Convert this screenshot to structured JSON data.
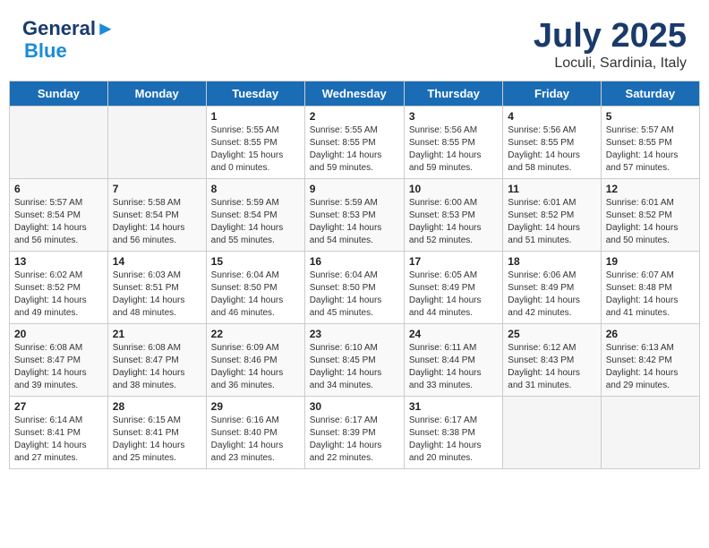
{
  "header": {
    "logo_line1": "General",
    "logo_line2": "Blue",
    "month": "July 2025",
    "location": "Loculi, Sardinia, Italy"
  },
  "weekdays": [
    "Sunday",
    "Monday",
    "Tuesday",
    "Wednesday",
    "Thursday",
    "Friday",
    "Saturday"
  ],
  "weeks": [
    [
      {
        "day": "",
        "info": ""
      },
      {
        "day": "",
        "info": ""
      },
      {
        "day": "1",
        "info": "Sunrise: 5:55 AM\nSunset: 8:55 PM\nDaylight: 15 hours\nand 0 minutes."
      },
      {
        "day": "2",
        "info": "Sunrise: 5:55 AM\nSunset: 8:55 PM\nDaylight: 14 hours\nand 59 minutes."
      },
      {
        "day": "3",
        "info": "Sunrise: 5:56 AM\nSunset: 8:55 PM\nDaylight: 14 hours\nand 59 minutes."
      },
      {
        "day": "4",
        "info": "Sunrise: 5:56 AM\nSunset: 8:55 PM\nDaylight: 14 hours\nand 58 minutes."
      },
      {
        "day": "5",
        "info": "Sunrise: 5:57 AM\nSunset: 8:55 PM\nDaylight: 14 hours\nand 57 minutes."
      }
    ],
    [
      {
        "day": "6",
        "info": "Sunrise: 5:57 AM\nSunset: 8:54 PM\nDaylight: 14 hours\nand 56 minutes."
      },
      {
        "day": "7",
        "info": "Sunrise: 5:58 AM\nSunset: 8:54 PM\nDaylight: 14 hours\nand 56 minutes."
      },
      {
        "day": "8",
        "info": "Sunrise: 5:59 AM\nSunset: 8:54 PM\nDaylight: 14 hours\nand 55 minutes."
      },
      {
        "day": "9",
        "info": "Sunrise: 5:59 AM\nSunset: 8:53 PM\nDaylight: 14 hours\nand 54 minutes."
      },
      {
        "day": "10",
        "info": "Sunrise: 6:00 AM\nSunset: 8:53 PM\nDaylight: 14 hours\nand 52 minutes."
      },
      {
        "day": "11",
        "info": "Sunrise: 6:01 AM\nSunset: 8:52 PM\nDaylight: 14 hours\nand 51 minutes."
      },
      {
        "day": "12",
        "info": "Sunrise: 6:01 AM\nSunset: 8:52 PM\nDaylight: 14 hours\nand 50 minutes."
      }
    ],
    [
      {
        "day": "13",
        "info": "Sunrise: 6:02 AM\nSunset: 8:52 PM\nDaylight: 14 hours\nand 49 minutes."
      },
      {
        "day": "14",
        "info": "Sunrise: 6:03 AM\nSunset: 8:51 PM\nDaylight: 14 hours\nand 48 minutes."
      },
      {
        "day": "15",
        "info": "Sunrise: 6:04 AM\nSunset: 8:50 PM\nDaylight: 14 hours\nand 46 minutes."
      },
      {
        "day": "16",
        "info": "Sunrise: 6:04 AM\nSunset: 8:50 PM\nDaylight: 14 hours\nand 45 minutes."
      },
      {
        "day": "17",
        "info": "Sunrise: 6:05 AM\nSunset: 8:49 PM\nDaylight: 14 hours\nand 44 minutes."
      },
      {
        "day": "18",
        "info": "Sunrise: 6:06 AM\nSunset: 8:49 PM\nDaylight: 14 hours\nand 42 minutes."
      },
      {
        "day": "19",
        "info": "Sunrise: 6:07 AM\nSunset: 8:48 PM\nDaylight: 14 hours\nand 41 minutes."
      }
    ],
    [
      {
        "day": "20",
        "info": "Sunrise: 6:08 AM\nSunset: 8:47 PM\nDaylight: 14 hours\nand 39 minutes."
      },
      {
        "day": "21",
        "info": "Sunrise: 6:08 AM\nSunset: 8:47 PM\nDaylight: 14 hours\nand 38 minutes."
      },
      {
        "day": "22",
        "info": "Sunrise: 6:09 AM\nSunset: 8:46 PM\nDaylight: 14 hours\nand 36 minutes."
      },
      {
        "day": "23",
        "info": "Sunrise: 6:10 AM\nSunset: 8:45 PM\nDaylight: 14 hours\nand 34 minutes."
      },
      {
        "day": "24",
        "info": "Sunrise: 6:11 AM\nSunset: 8:44 PM\nDaylight: 14 hours\nand 33 minutes."
      },
      {
        "day": "25",
        "info": "Sunrise: 6:12 AM\nSunset: 8:43 PM\nDaylight: 14 hours\nand 31 minutes."
      },
      {
        "day": "26",
        "info": "Sunrise: 6:13 AM\nSunset: 8:42 PM\nDaylight: 14 hours\nand 29 minutes."
      }
    ],
    [
      {
        "day": "27",
        "info": "Sunrise: 6:14 AM\nSunset: 8:41 PM\nDaylight: 14 hours\nand 27 minutes."
      },
      {
        "day": "28",
        "info": "Sunrise: 6:15 AM\nSunset: 8:41 PM\nDaylight: 14 hours\nand 25 minutes."
      },
      {
        "day": "29",
        "info": "Sunrise: 6:16 AM\nSunset: 8:40 PM\nDaylight: 14 hours\nand 23 minutes."
      },
      {
        "day": "30",
        "info": "Sunrise: 6:17 AM\nSunset: 8:39 PM\nDaylight: 14 hours\nand 22 minutes."
      },
      {
        "day": "31",
        "info": "Sunrise: 6:17 AM\nSunset: 8:38 PM\nDaylight: 14 hours\nand 20 minutes."
      },
      {
        "day": "",
        "info": ""
      },
      {
        "day": "",
        "info": ""
      }
    ]
  ]
}
